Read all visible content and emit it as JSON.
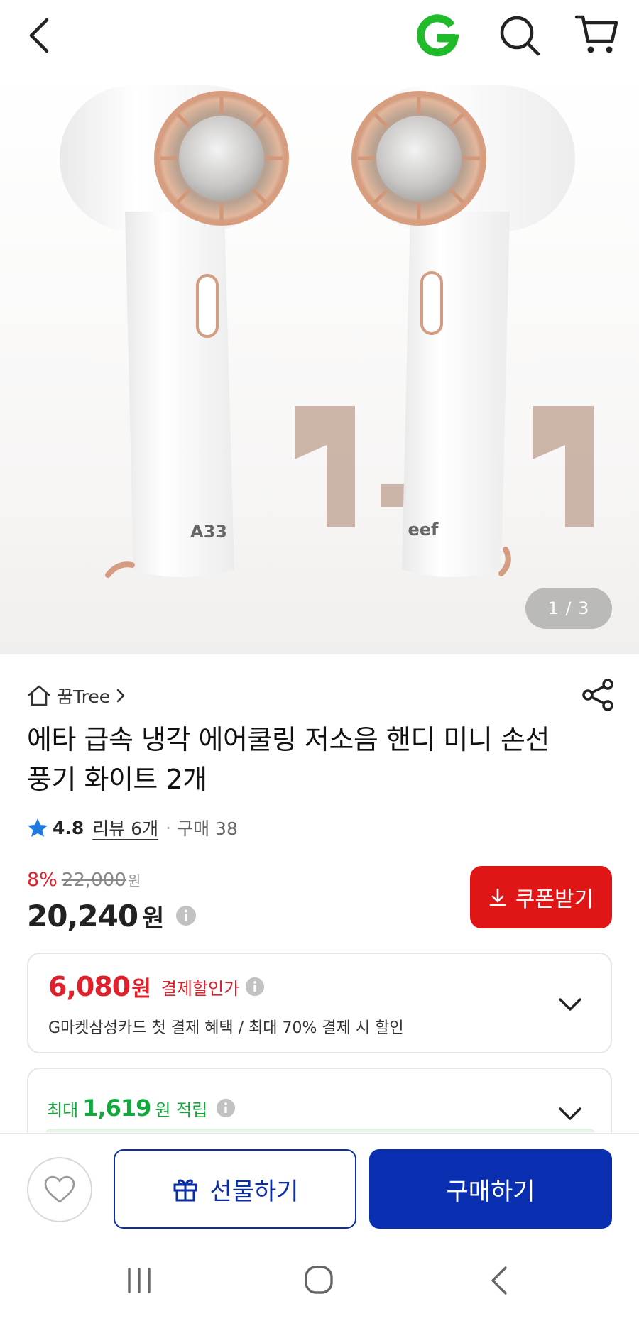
{
  "topbar": {
    "icons": [
      "back-icon",
      "gmarket-g-logo",
      "search-icon",
      "cart-icon"
    ]
  },
  "hero": {
    "pager": "1 / 3",
    "product_marks": [
      "1+1"
    ],
    "brand_colors": {
      "fan_body": "#ffffff",
      "accent_rose_gold": "#d9a58a",
      "badge_text": "#c9b2a4"
    }
  },
  "product": {
    "store_name": "꿈Tree",
    "title": "에타 급속 냉각 에어쿨링 저소음 핸디 미니 손선풍기 화이트 2개",
    "rating": "4.8",
    "review_label": "리뷰 6개",
    "separator": "·",
    "purchase_label": "구매 38"
  },
  "pricing": {
    "discount_pct": "8%",
    "original_price": "22,000",
    "original_unit": "원",
    "price": "20,240",
    "price_unit": "원",
    "coupon_button": "쿠폰받기"
  },
  "payment_discount": {
    "amount": "6,080",
    "unit": "원",
    "label": "결제할인가",
    "desc": "G마켓삼성카드 첫 결제 혜택 / 최대 70% 결제 시 할인"
  },
  "points": {
    "prefix": "최대",
    "amount": "1,619",
    "suffix": "원 적립"
  },
  "actions": {
    "gift_button": "선물하기",
    "buy_button": "구매하기"
  },
  "colors": {
    "accent_red": "#e01616",
    "accent_blue": "#0a2eb0",
    "points_green": "#12a83e",
    "star_blue": "#1f7ae0"
  }
}
